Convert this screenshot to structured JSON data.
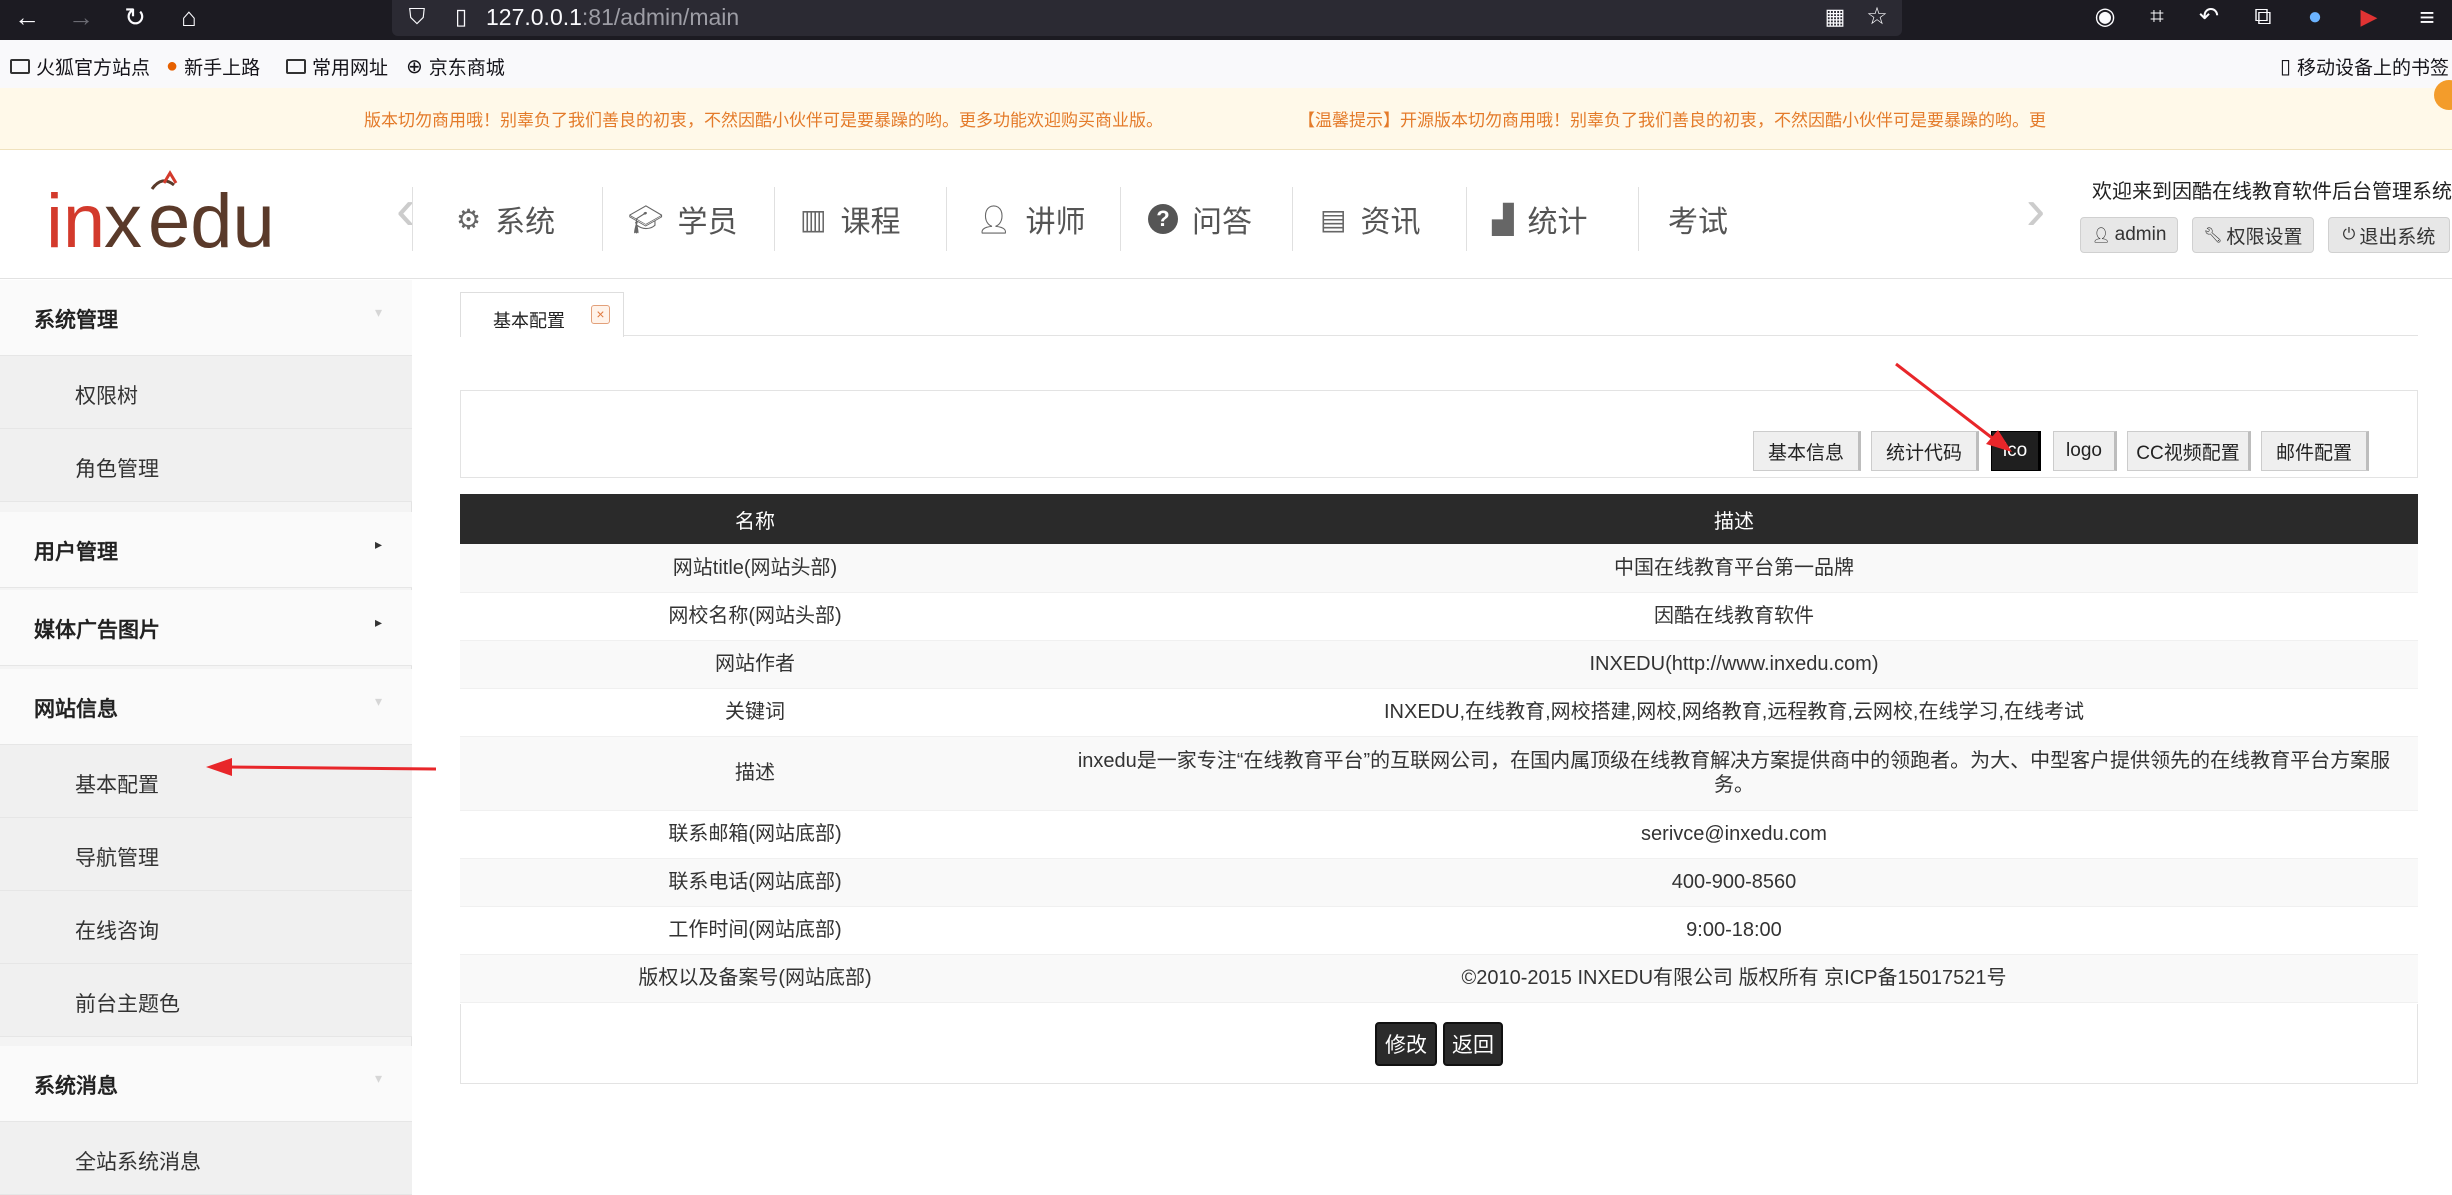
{
  "browser": {
    "url_host": "127.0.0.1",
    "url_rest": ":81/admin/main",
    "bookmarks": [
      "火狐官方站点",
      "新手上路",
      "常用网址",
      "京东商城"
    ],
    "mobile_bookmarks": "移动设备上的书签"
  },
  "notice": {
    "left": "版本切勿商用哦！别辜负了我们善良的初衷，不然因酷小伙伴可是要暴躁的哟。更多功能欢迎购买商业版。",
    "right": "【温馨提示】开源版本切勿商用哦！别辜负了我们善良的初衷，不然因酷小伙伴可是要暴躁的哟。更"
  },
  "header": {
    "logo_text": "inxedu",
    "nav": [
      {
        "label": "系统",
        "icon": "gear-icon"
      },
      {
        "label": "学员",
        "icon": "graduation-cap-icon"
      },
      {
        "label": "课程",
        "icon": "books-icon"
      },
      {
        "label": "讲师",
        "icon": "user-icon"
      },
      {
        "label": "问答",
        "icon": "question-icon"
      },
      {
        "label": "资讯",
        "icon": "news-icon"
      },
      {
        "label": "统计",
        "icon": "bar-chart-icon"
      },
      {
        "label": "考试",
        "icon": ""
      }
    ],
    "welcome": "欢迎来到因酷在线教育软件后台管理系统!",
    "buttons": {
      "admin": "admin",
      "permission": "权限设置",
      "logout": "退出系统"
    }
  },
  "sidebar": {
    "groups": [
      {
        "label": "系统管理",
        "items": [
          "权限树",
          "角色管理"
        ]
      },
      {
        "label": "用户管理",
        "items": []
      },
      {
        "label": "媒体广告图片",
        "items": []
      },
      {
        "label": "网站信息",
        "items": [
          "基本配置",
          "导航管理",
          "在线咨询",
          "前台主题色"
        ]
      },
      {
        "label": "系统消息",
        "items": [
          "全站系统消息"
        ]
      }
    ]
  },
  "tab": {
    "label": "基本配置",
    "close": "×"
  },
  "toolbar": [
    "基本信息",
    "统计代码",
    "ico",
    "logo",
    "CC视频配置",
    "邮件配置"
  ],
  "toolbar_active": "ico",
  "table": {
    "headers": [
      "名称",
      "描述"
    ],
    "rows": [
      [
        "网站title(网站头部)",
        "中国在线教育平台第一品牌"
      ],
      [
        "网校名称(网站头部)",
        "因酷在线教育软件"
      ],
      [
        "网站作者",
        "INXEDU(http://www.inxedu.com)"
      ],
      [
        "关键词",
        "INXEDU,在线教育,网校搭建,网校,网络教育,远程教育,云网校,在线学习,在线考试"
      ],
      [
        "描述",
        "inxedu是一家专注“在线教育平台”的互联网公司，在国内属顶级在线教育解决方案提供商中的领跑者。为大、中型客户提供领先的在线教育平台方案服务。"
      ],
      [
        "联系邮箱(网站底部)",
        "serivce@inxedu.com"
      ],
      [
        "联系电话(网站底部)",
        "400-900-8560"
      ],
      [
        "工作时间(网站底部)",
        "9:00-18:00"
      ],
      [
        "版权以及备案号(网站底部)",
        "©2010-2015 INXEDU有限公司 版权所有 京ICP备15017521号"
      ]
    ],
    "edit": "修改",
    "back": "返回"
  }
}
